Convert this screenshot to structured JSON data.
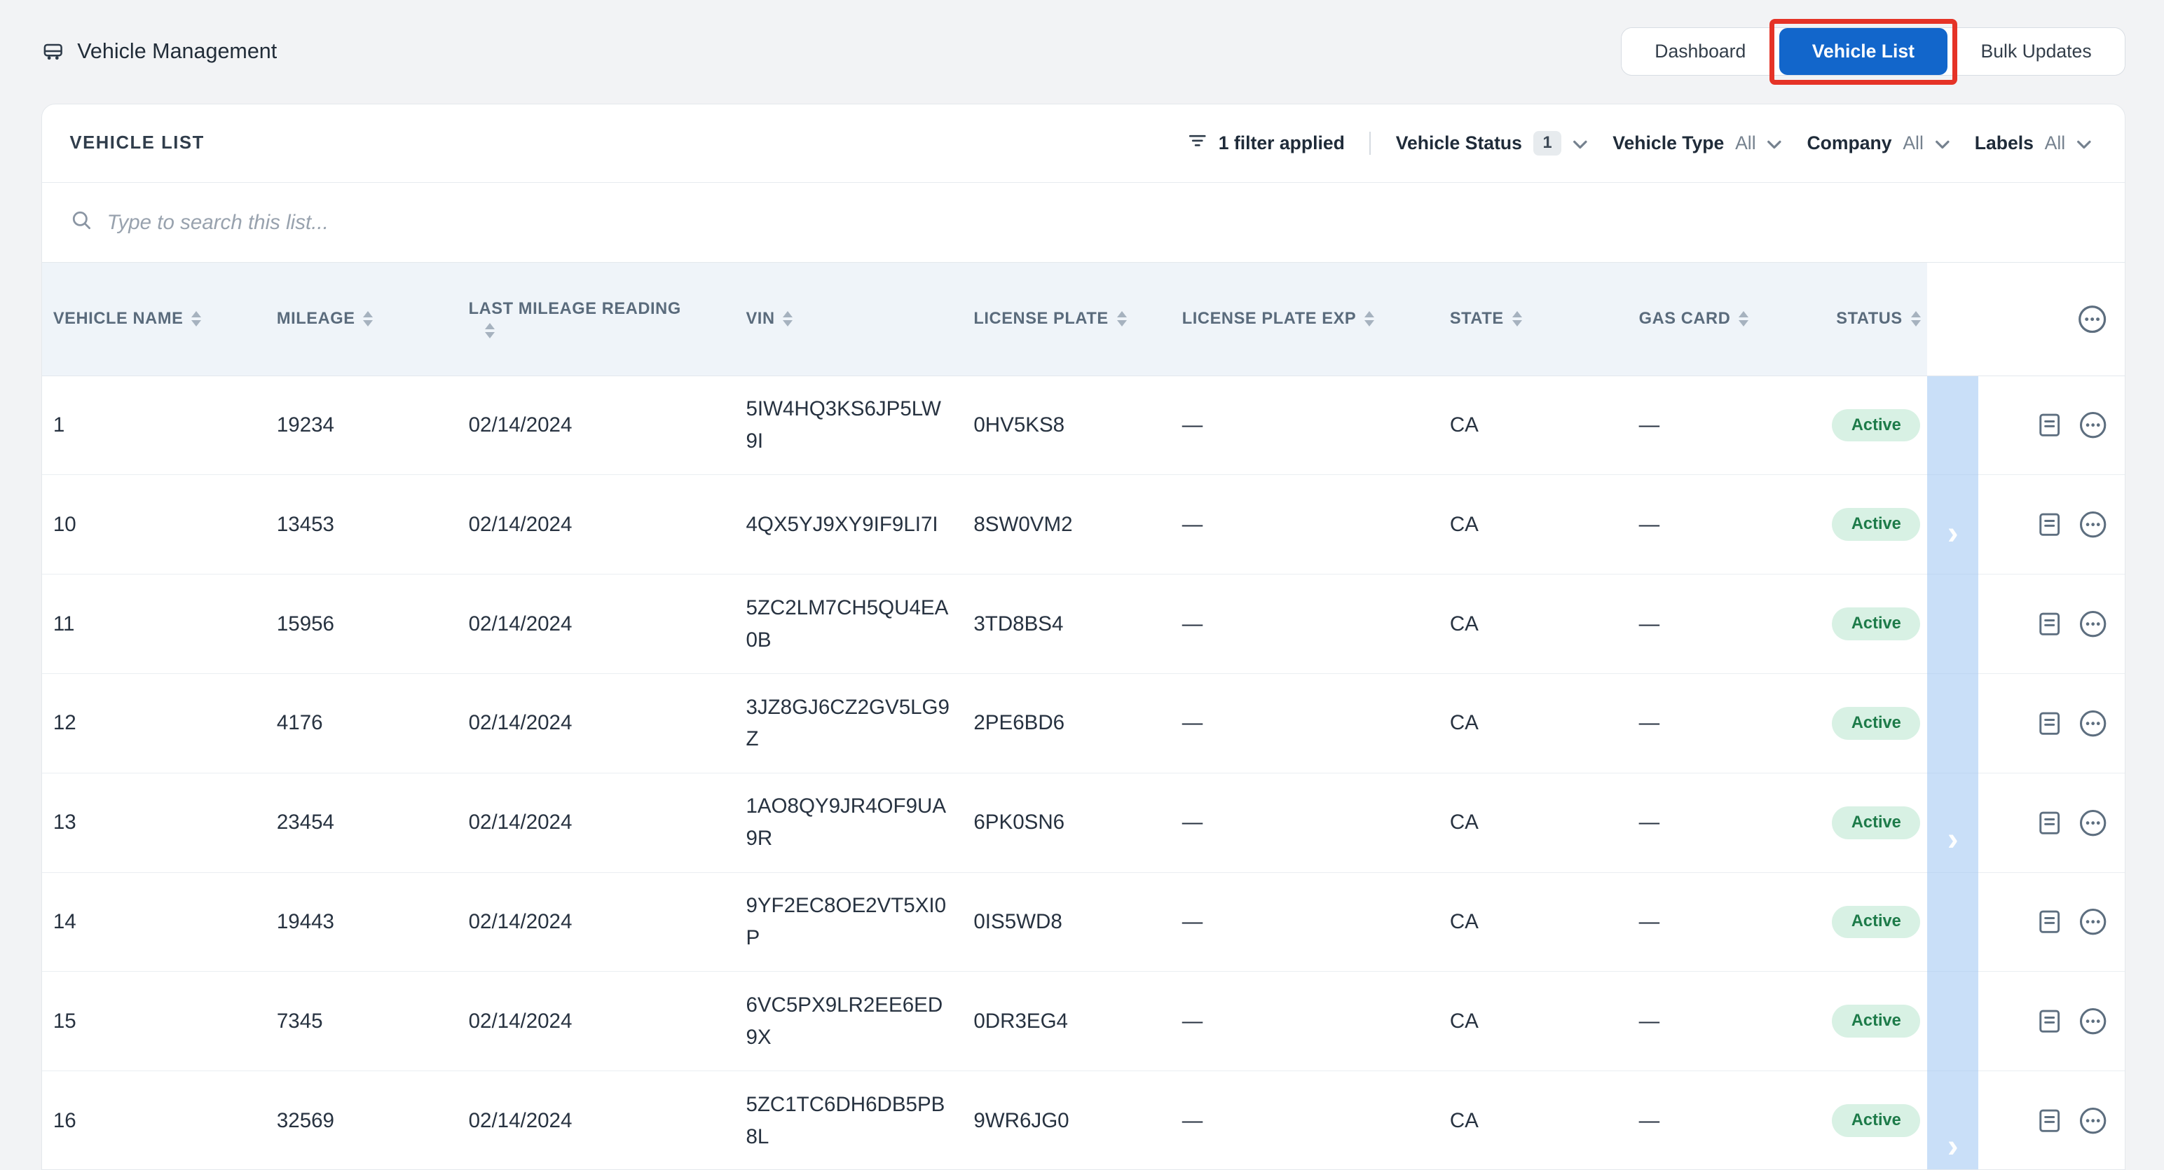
{
  "header": {
    "title": "Vehicle Management",
    "tabs": [
      {
        "label": "Dashboard",
        "active": false
      },
      {
        "label": "Vehicle List",
        "active": true
      },
      {
        "label": "Bulk Updates",
        "active": false
      }
    ]
  },
  "panel": {
    "title": "VEHICLE LIST",
    "filters_applied": "1 filter applied",
    "filters": [
      {
        "label": "Vehicle Status",
        "value": "1"
      },
      {
        "label": "Vehicle Type",
        "value": "All"
      },
      {
        "label": "Company",
        "value": "All"
      },
      {
        "label": "Labels",
        "value": "All"
      }
    ],
    "search_placeholder": "Type to search this list..."
  },
  "table": {
    "columns": [
      "VEHICLE NAME",
      "MILEAGE",
      "LAST MILEAGE READING",
      "VIN",
      "LICENSE PLATE",
      "LICENSE PLATE EXP",
      "STATE",
      "GAS CARD",
      "STATUS"
    ],
    "rows": [
      {
        "name": "1",
        "mileage": "19234",
        "reading": "02/14/2024",
        "vin": "5IW4HQ3KS6JP5LW9I",
        "plate": "0HV5KS8",
        "plate_exp": "—",
        "state": "CA",
        "gas": "—",
        "status": "Active"
      },
      {
        "name": "10",
        "mileage": "13453",
        "reading": "02/14/2024",
        "vin": "4QX5YJ9XY9IF9LI7I",
        "plate": "8SW0VM2",
        "plate_exp": "—",
        "state": "CA",
        "gas": "—",
        "status": "Active"
      },
      {
        "name": "11",
        "mileage": "15956",
        "reading": "02/14/2024",
        "vin": "5ZC2LM7CH5QU4EA0B",
        "plate": "3TD8BS4",
        "plate_exp": "—",
        "state": "CA",
        "gas": "—",
        "status": "Active"
      },
      {
        "name": "12",
        "mileage": "4176",
        "reading": "02/14/2024",
        "vin": "3JZ8GJ6CZ2GV5LG9Z",
        "plate": "2PE6BD6",
        "plate_exp": "—",
        "state": "CA",
        "gas": "—",
        "status": "Active"
      },
      {
        "name": "13",
        "mileage": "23454",
        "reading": "02/14/2024",
        "vin": "1AO8QY9JR4OF9UA9R",
        "plate": "6PK0SN6",
        "plate_exp": "—",
        "state": "CA",
        "gas": "—",
        "status": "Active"
      },
      {
        "name": "14",
        "mileage": "19443",
        "reading": "02/14/2024",
        "vin": "9YF2EC8OE2VT5XI0P",
        "plate": "0IS5WD8",
        "plate_exp": "—",
        "state": "CA",
        "gas": "—",
        "status": "Active"
      },
      {
        "name": "15",
        "mileage": "7345",
        "reading": "02/14/2024",
        "vin": "6VC5PX9LR2EE6ED9X",
        "plate": "0DR3EG4",
        "plate_exp": "—",
        "state": "CA",
        "gas": "—",
        "status": "Active"
      },
      {
        "name": "16",
        "mileage": "32569",
        "reading": "02/14/2024",
        "vin": "5ZC1TC6DH6DB5PB8L",
        "plate": "9WR6JG0",
        "plate_exp": "—",
        "state": "CA",
        "gas": "—",
        "status": "Active"
      }
    ]
  },
  "icons": {
    "title": "vehicle-icon",
    "filter": "filter-icon",
    "search": "search-icon",
    "sort": "sort-arrows-icon",
    "row": [
      "document-icon",
      "more-options-icon"
    ],
    "scroll": "chevron-right-icon"
  },
  "colors": {
    "accent_blue": "#1266cb",
    "highlight_red": "#e53327",
    "status_green_bg": "#d8f1e4",
    "status_green_text": "#1d7b49",
    "table_header_bg": "#eff4f9",
    "scroll_strip": "#9cc4f2"
  }
}
